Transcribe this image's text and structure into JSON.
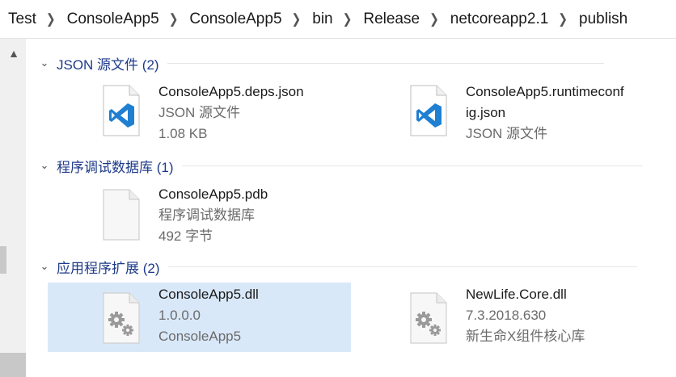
{
  "breadcrumb": [
    "Test",
    "ConsoleApp5",
    "ConsoleApp5",
    "bin",
    "Release",
    "netcoreapp2.1",
    "publish"
  ],
  "groups": [
    {
      "title": "JSON 源文件 (2)",
      "items": [
        {
          "name": "ConsoleApp5.deps.json",
          "line2": "JSON 源文件",
          "line3": "1.08 KB",
          "icon": "vscode-json-file-icon"
        },
        {
          "name": "ConsoleApp5.runtimeconf",
          "name2": "ig.json",
          "line2": "JSON 源文件",
          "icon": "vscode-json-file-icon"
        }
      ]
    },
    {
      "title": "程序调试数据库 (1)",
      "items": [
        {
          "name": "ConsoleApp5.pdb",
          "line2": "程序调试数据库",
          "line3": "492 字节",
          "icon": "blank-file-icon"
        }
      ]
    },
    {
      "title": "应用程序扩展 (2)",
      "items": [
        {
          "name": "ConsoleApp5.dll",
          "line2": "1.0.0.0",
          "line3": "ConsoleApp5",
          "icon": "dll-gear-file-icon"
        },
        {
          "name": "NewLife.Core.dll",
          "line2": "7.3.2018.630",
          "line3": "新生命X组件核心库",
          "icon": "dll-gear-file-icon"
        }
      ]
    }
  ],
  "colors": {
    "group_header": "#1e3a8a",
    "selection": "#d9e8f8",
    "vscode_blue": "#1f7fd1"
  }
}
